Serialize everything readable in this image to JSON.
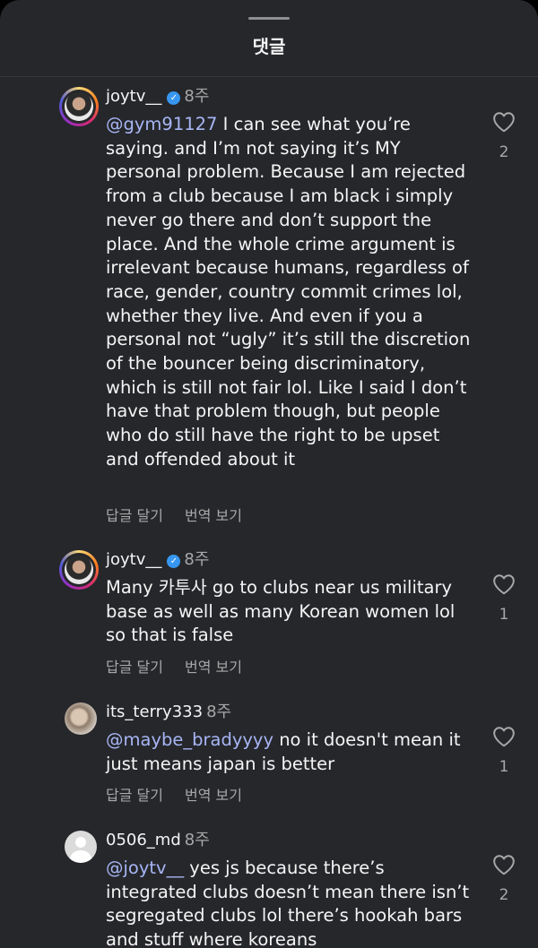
{
  "sheet": {
    "title": "댓글"
  },
  "comments": [
    {
      "username": "joytv__",
      "verified": true,
      "time": "8주",
      "mention": "@gym91127",
      "text": " I can see what you’re saying. and I’m not saying it’s MY personal problem. Because I am rejected from a club because I am black i simply never go there and don’t support the place. And the whole crime argument is irrelevant because humans, regardless of race, gender, country commit crimes lol, whether they live. And even if you a personal not “ugly” it’s still the discretion of the bouncer being discriminatory, which is still not fair lol. Like I said I don’t have that problem though, but people who do still have the right to be upset and offended about it",
      "reply_label": "답글 달기",
      "translate_label": "번역 보기",
      "likes": "2"
    },
    {
      "username": "joytv__",
      "verified": true,
      "time": "8주",
      "mention": "",
      "text": "Many 카투사 go to clubs near us military base as well as many Korean women lol so that is  false",
      "reply_label": "답글 달기",
      "translate_label": "번역 보기",
      "likes": "1"
    },
    {
      "username": "its_terry333",
      "verified": false,
      "time": "8주",
      "mention": "@maybe_bradyyyy",
      "text": " no it doesn't mean it just means japan is better",
      "reply_label": "답글 달기",
      "translate_label": "번역 보기",
      "likes": "1"
    },
    {
      "username": "0506_md",
      "verified": false,
      "time": "8주",
      "mention": "@joytv__",
      "text": " yes js because there’s integrated clubs doesn’t mean there isn’t segregated clubs lol there’s hookah bars and stuff where koreans",
      "likes": "2"
    }
  ]
}
